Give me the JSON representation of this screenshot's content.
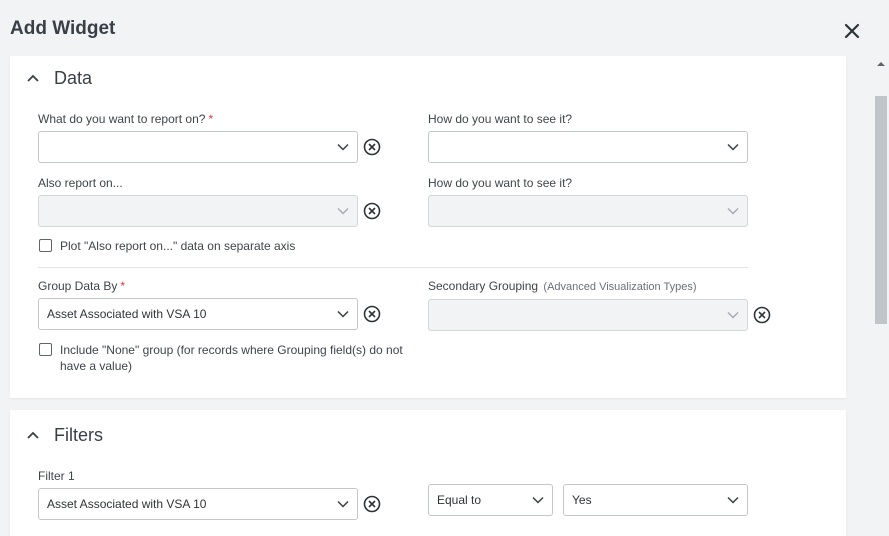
{
  "header": {
    "title": "Add Widget",
    "close_icon": "close-icon"
  },
  "data_section": {
    "title": "Data",
    "report_on": {
      "label": "What do you want to report on?",
      "required": "*",
      "value": ""
    },
    "see_it_1": {
      "label": "How do you want to see it?",
      "value": ""
    },
    "also_report": {
      "label": "Also report on...",
      "value": ""
    },
    "see_it_2": {
      "label": "How do you want to see it?",
      "value": ""
    },
    "plot_separate": {
      "label": "Plot \"Also report on...\" data on separate axis",
      "checked": false
    },
    "group_by": {
      "label": "Group Data By",
      "required": "*",
      "value": "Asset Associated with VSA 10"
    },
    "secondary": {
      "label": "Secondary Grouping",
      "sublabel": "(Advanced Visualization Types)",
      "value": ""
    },
    "include_none": {
      "label": "Include \"None\" group (for records where Grouping field(s) do not have a value)",
      "checked": false
    }
  },
  "filters_section": {
    "title": "Filters",
    "filter1": {
      "label": "Filter 1",
      "field": "Asset Associated with VSA 10",
      "operator": "Equal to",
      "value": "Yes"
    }
  },
  "colors": {
    "accent_required": "#d9363e",
    "background": "#f2f3f5",
    "card": "#ffffff"
  }
}
